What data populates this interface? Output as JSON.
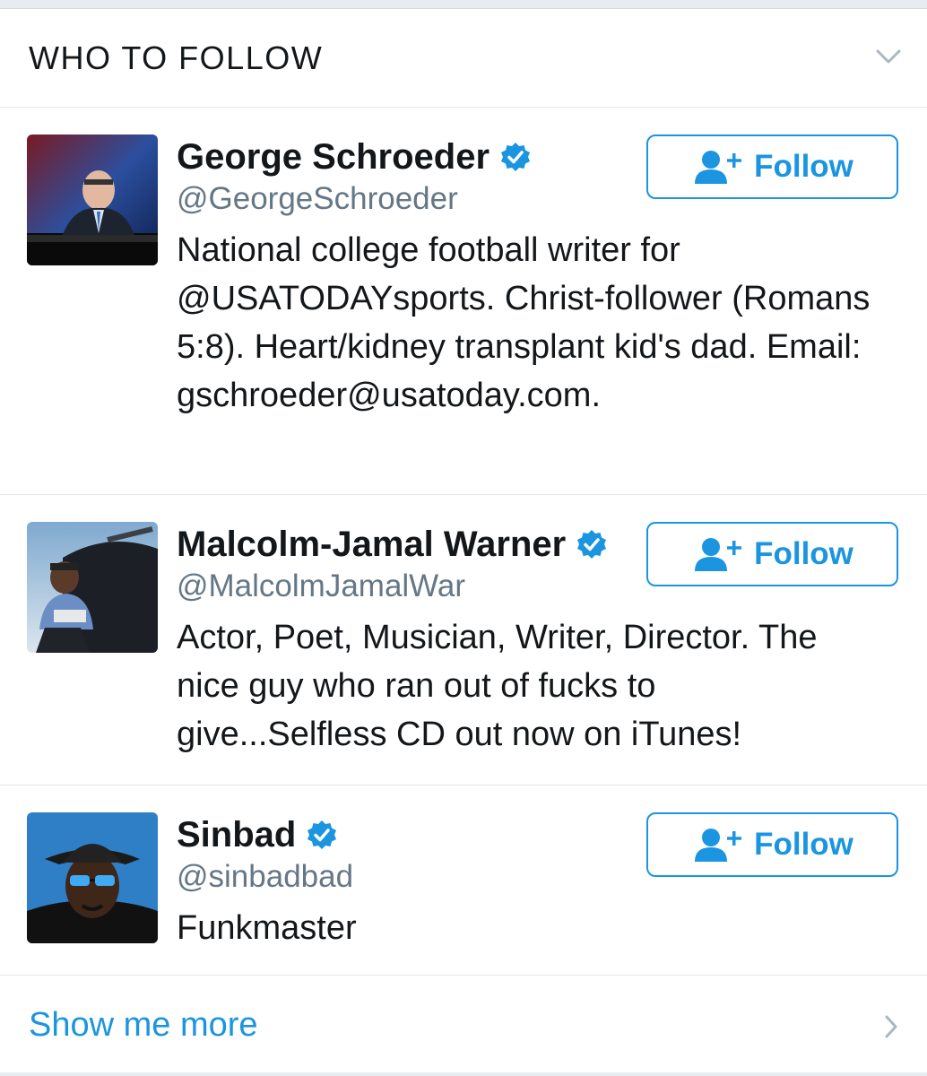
{
  "header": {
    "title": "WHO TO FOLLOW",
    "collapse_icon": "chevron-down-icon"
  },
  "suggestions": [
    {
      "name": "George Schroeder",
      "handle": "@GeorgeSchroeder",
      "verified": true,
      "bio": "National college football writer for @USATODAYsports. Christ-follower (Romans 5:8). Heart/kidney transplant kid's dad. Email: gschroeder@usatoday.com.",
      "follow_label": "Follow"
    },
    {
      "name": "Malcolm-Jamal Warner",
      "handle": "@MalcolmJamalWar",
      "verified": true,
      "bio": "Actor, Poet, Musician, Writer, Director. The nice guy who ran out of fucks to give...Selfless CD out now on iTunes!",
      "follow_label": "Follow"
    },
    {
      "name": "Sinbad",
      "handle": "@sinbadbad",
      "verified": true,
      "bio": "Funkmaster",
      "follow_label": "Follow"
    }
  ],
  "footer": {
    "show_more_label": "Show me more",
    "chevron_icon": "chevron-right-icon"
  },
  "colors": {
    "accent": "#1b95e0",
    "text": "#14171a",
    "secondary_text": "#657786",
    "divider": "#e1e8ed"
  }
}
